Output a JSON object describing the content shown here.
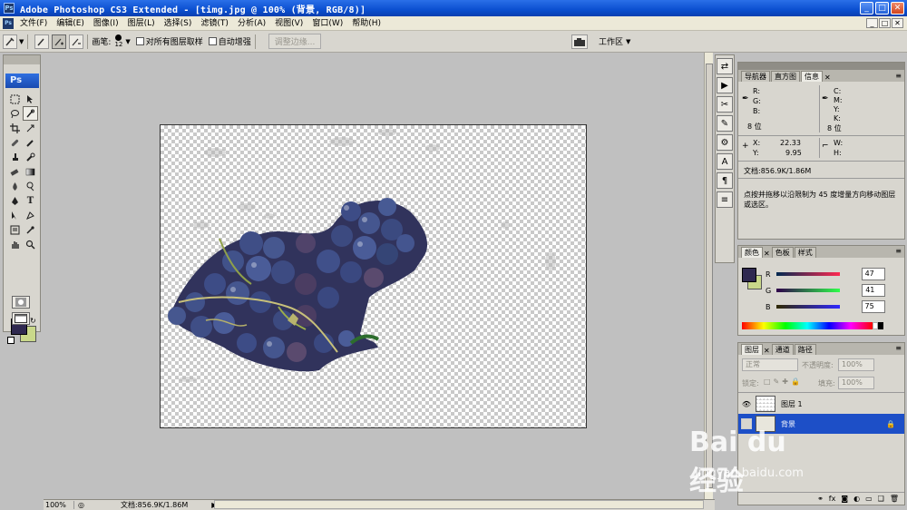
{
  "titlebar": {
    "title": "Adobe Photoshop CS3 Extended - [timg.jpg @ 100% (背景, RGB/8)]",
    "ps_logo": "Ps"
  },
  "window_buttons": {
    "minimize": "_",
    "maximize": "□",
    "close": "✕"
  },
  "menubar": {
    "items": [
      "文件(F)",
      "编辑(E)",
      "图像(I)",
      "图层(L)",
      "选择(S)",
      "滤镜(T)",
      "分析(A)",
      "视图(V)",
      "窗口(W)",
      "帮助(H)"
    ]
  },
  "options": {
    "brush_label": "画笔:",
    "brush_size": "12",
    "sample_all_layers": "对所有图层取样",
    "auto_enhance": "自动增强",
    "refine_edge": "调整边缘...",
    "workspace": "工作区"
  },
  "toolbox": {
    "badge": "Ps",
    "fg_color": "#2f2950",
    "bg_color": "#c9d88a"
  },
  "status": {
    "zoom": "100%",
    "doc": "文档:856.9K/1.86M"
  },
  "info_panel": {
    "tabs": [
      "导航器",
      "直方图",
      "信息"
    ],
    "r": "R:",
    "g": "G:",
    "b": "B:",
    "c": "C:",
    "m": "M:",
    "y": "Y:",
    "k": "K:",
    "bits_left": "8 位",
    "bits_right": "8 位",
    "x_label": "X:",
    "x_value": "22.33",
    "y_label": "Y:",
    "y_value": "9.95",
    "w_label": "W:",
    "h_label": "H:",
    "doc": "文档:856.9K/1.86M",
    "hint": "点按并拖移以沿限制为 45 度增量方向移动图层或选区。"
  },
  "color_panel": {
    "tabs": [
      "颜色",
      "色板",
      "样式"
    ],
    "r_label": "R",
    "r_value": "47",
    "g_label": "G",
    "g_value": "41",
    "b_label": "B",
    "b_value": "75"
  },
  "layers_panel": {
    "tabs": [
      "图层",
      "通道",
      "路径"
    ],
    "blend_mode": "正常",
    "opacity_label": "不透明度:",
    "opacity_value": "100%",
    "lock_label": "锁定:",
    "fill_label": "填充:",
    "fill_value": "100%",
    "layers": [
      {
        "name": "图层 1",
        "visible": true,
        "selected": false
      },
      {
        "name": "背景",
        "visible": false,
        "selected": true
      }
    ]
  },
  "watermark": {
    "brand": "Bai du 经验",
    "url": "jingyan.baidu.com"
  },
  "colors": {
    "title_blue": "#0b4fd0",
    "selection_blue": "#1d4fc7"
  }
}
